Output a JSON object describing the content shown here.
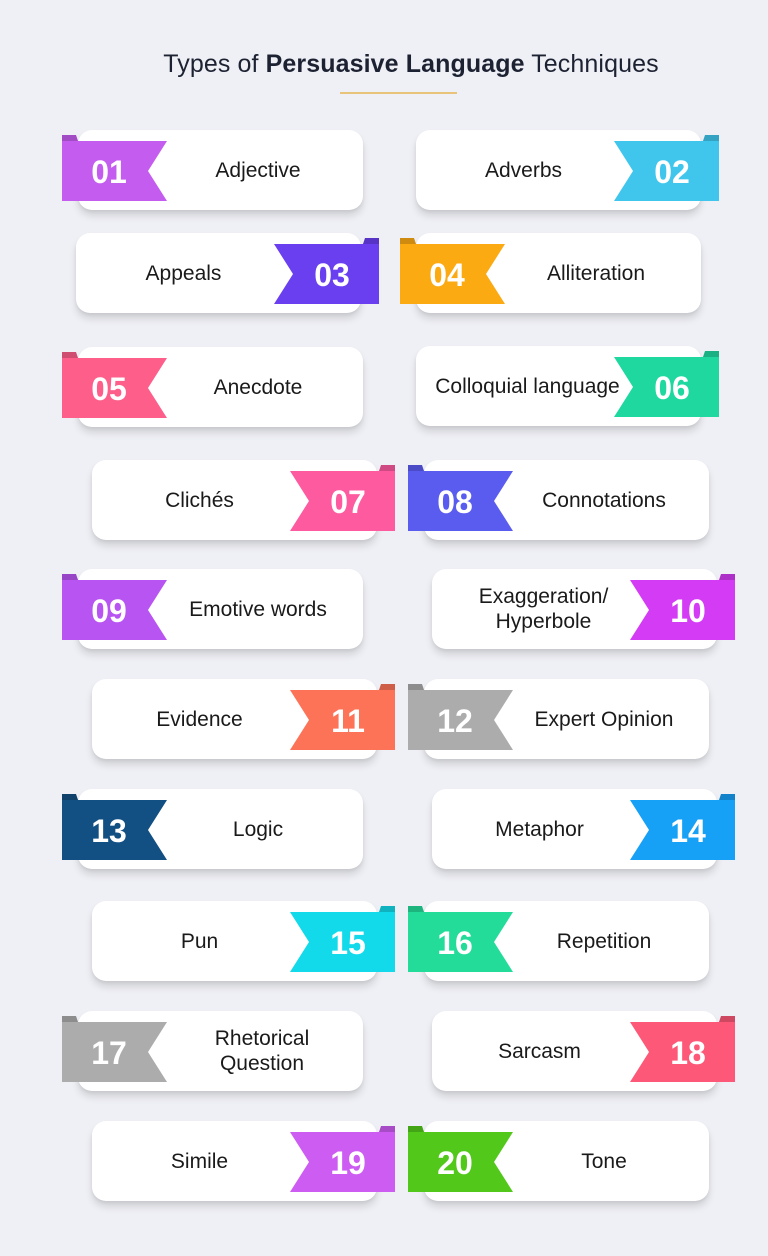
{
  "title": {
    "prefix": "Types of ",
    "emphasis": "Persuasive Language",
    "suffix": " Techniques",
    "underline_color": "#e8c47a"
  },
  "items": [
    {
      "number": "01",
      "label": "Adjective",
      "color": "#c45cf0"
    },
    {
      "number": "02",
      "label": "Adverbs",
      "color": "#40c6ec"
    },
    {
      "number": "03",
      "label": "Appeals",
      "color": "#6a3ff0"
    },
    {
      "number": "04",
      "label": "Alliteration",
      "color": "#fbaa12"
    },
    {
      "number": "05",
      "label": "Anecdote",
      "color": "#fd5e8a"
    },
    {
      "number": "06",
      "label": "Colloquial language",
      "color": "#1ed8a0"
    },
    {
      "number": "07",
      "label": "Clichés",
      "color": "#fd5aa0"
    },
    {
      "number": "08",
      "label": "Connotations",
      "color": "#5a5cf0"
    },
    {
      "number": "09",
      "label": "Emotive words",
      "color": "#b854f2"
    },
    {
      "number": "10",
      "label": "Exaggeration/ Hyperbole",
      "color": "#d33cf4"
    },
    {
      "number": "11",
      "label": "Evidence",
      "color": "#fd7358"
    },
    {
      "number": "12",
      "label": "Expert Opinion",
      "color": "#acacac"
    },
    {
      "number": "13",
      "label": "Logic",
      "color": "#124f82"
    },
    {
      "number": "14",
      "label": "Metaphor",
      "color": "#16a0f6"
    },
    {
      "number": "15",
      "label": "Pun",
      "color": "#12daea"
    },
    {
      "number": "16",
      "label": "Repetition",
      "color": "#24dc9a"
    },
    {
      "number": "17",
      "label": "Rhetorical Question",
      "color": "#acacac"
    },
    {
      "number": "18",
      "label": "Sarcasm",
      "color": "#fd5878"
    },
    {
      "number": "19",
      "label": "Simile",
      "color": "#cc5cf2"
    },
    {
      "number": "20",
      "label": "Tone",
      "color": "#52c81a"
    }
  ]
}
